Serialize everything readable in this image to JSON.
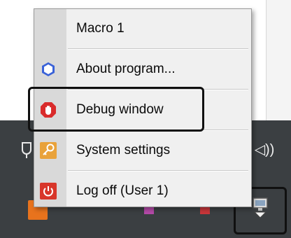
{
  "menu": {
    "items": [
      {
        "label": "Macro 1",
        "icon": "none"
      },
      {
        "label": "About program...",
        "icon": "hexagon-icon"
      },
      {
        "label": "Debug window",
        "icon": "stop-hand-icon"
      },
      {
        "label": "System settings",
        "icon": "key-icon"
      },
      {
        "label": "Log off (User 1)",
        "icon": "power-icon"
      }
    ],
    "highlighted_item": "Debug window"
  },
  "taskbar": {
    "sound_glyph": "◁))",
    "tray_left_glyph": "◖"
  },
  "colors": {
    "menu_background": "#f0f0f0",
    "menu_gutter": "#d9d9d9",
    "taskbar": "#3b3f42",
    "about_icon": "#3a62d8",
    "debug_icon": "#d92b2b",
    "settings_icon": "#e9a23a",
    "logoff_icon": "#d8362a",
    "taskbar_app": "#e8731d"
  }
}
